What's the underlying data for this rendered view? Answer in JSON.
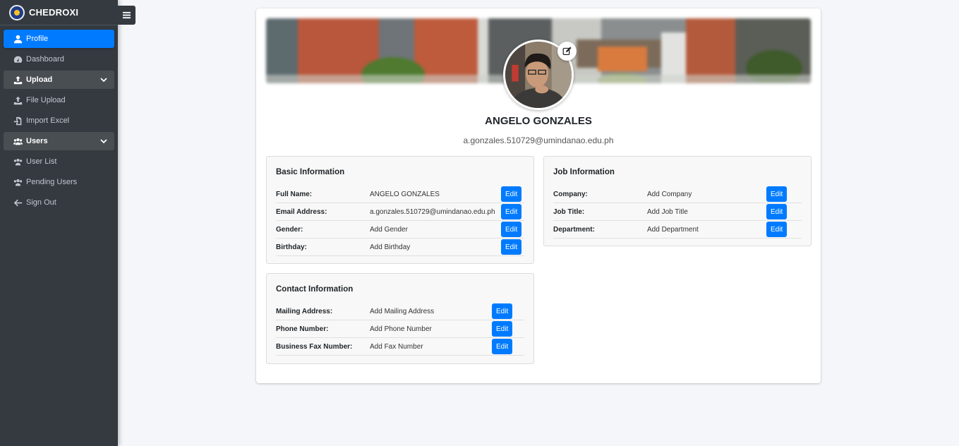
{
  "brand": {
    "name": "CHEDROXI"
  },
  "sidebar": {
    "items": [
      {
        "label": "Profile",
        "icon": "user-icon"
      },
      {
        "label": "Dashboard",
        "icon": "tachometer-icon"
      },
      {
        "label": "Upload",
        "icon": "upload-icon"
      },
      {
        "label": "File Upload",
        "icon": "upload-icon"
      },
      {
        "label": "Import Excel",
        "icon": "file-import-icon"
      },
      {
        "label": "Users",
        "icon": "users-icon"
      },
      {
        "label": "User List",
        "icon": "users-icon"
      },
      {
        "label": "Pending Users",
        "icon": "users-icon"
      },
      {
        "label": "Sign Out",
        "icon": "arrow-left-icon"
      }
    ]
  },
  "profile": {
    "name": "ANGELO GONZALES",
    "email": "a.gonzales.510729@umindanao.edu.ph"
  },
  "basic": {
    "title": "Basic Information",
    "rows": [
      {
        "label": "Full Name:",
        "value": "ANGELO GONZALES",
        "action": "Edit"
      },
      {
        "label": "Email Address:",
        "value": "a.gonzales.510729@umindanao.edu.ph",
        "action": "Edit"
      },
      {
        "label": "Gender:",
        "value": "Add Gender",
        "action": "Edit"
      },
      {
        "label": "Birthday:",
        "value": "Add Birthday",
        "action": "Edit"
      }
    ]
  },
  "job": {
    "title": "Job Information",
    "rows": [
      {
        "label": "Company:",
        "value": "Add Company",
        "action": "Edit"
      },
      {
        "label": "Job Title:",
        "value": "Add Job Title",
        "action": "Edit"
      },
      {
        "label": "Department:",
        "value": "Add Department",
        "action": "Edit"
      }
    ]
  },
  "contact": {
    "title": "Contact Information",
    "rows": [
      {
        "label": "Mailing Address:",
        "value": "Add Mailing Address",
        "action": "Edit"
      },
      {
        "label": "Phone Number:",
        "value": "Add Phone Number",
        "action": "Edit"
      },
      {
        "label": "Business Fax Number:",
        "value": "Add Fax Number",
        "action": "Edit"
      }
    ]
  },
  "colors": {
    "sidebar_bg": "#343a40",
    "active": "#007bff",
    "page_bg": "#f4f6f9"
  }
}
